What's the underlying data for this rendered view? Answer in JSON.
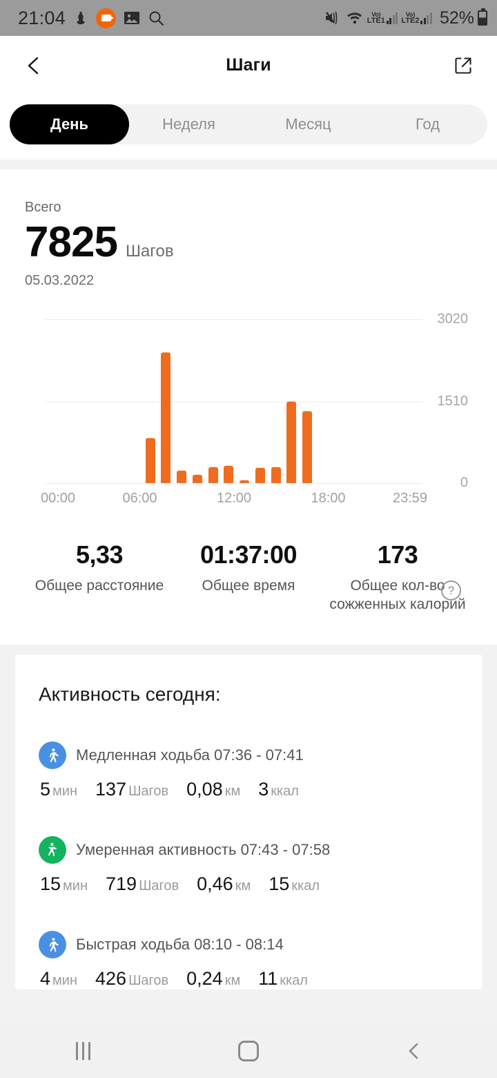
{
  "status_bar": {
    "time": "21:04",
    "left_icons": [
      "alarm-icon",
      "camera-recording-icon",
      "gallery-icon",
      "search-icon"
    ],
    "mute_icon": "mute-vibrate-icon",
    "wifi_icon": "wifi-icon",
    "sim1_label": "LTE1",
    "sim1_volte": "Vo)",
    "sim2_label": "LTE2",
    "sim2_volte": "Vo)",
    "battery_percent": "52%"
  },
  "appbar": {
    "back_icon": "back-chevron-icon",
    "title": "Шаги",
    "share_icon": "external-link-icon"
  },
  "tabs": [
    {
      "label": "День",
      "active": true
    },
    {
      "label": "Неделя",
      "active": false
    },
    {
      "label": "Месяц",
      "active": false
    },
    {
      "label": "Год",
      "active": false
    }
  ],
  "total": {
    "caption": "Всего",
    "value": "7825",
    "unit": "Шагов",
    "date": "05.03.2022"
  },
  "chart_data": {
    "type": "bar",
    "title": "",
    "xlabel": "",
    "ylabel": "",
    "ylim": [
      0,
      3020
    ],
    "grid": true,
    "legend": "none",
    "accent_color": "#ef6c1f",
    "yticks": [
      "0",
      "1510",
      "3020"
    ],
    "ytick_values": [
      0,
      1510,
      3020
    ],
    "xticks": [
      "00:00",
      "06:00",
      "12:00",
      "18:00",
      "23:59"
    ],
    "xtick_hours": [
      0,
      6,
      12,
      18,
      24
    ],
    "categories": [
      "06:40",
      "07:40",
      "08:40",
      "09:40",
      "10:40",
      "11:40",
      "12:40",
      "13:40",
      "14:40",
      "15:40",
      "16:40"
    ],
    "values": [
      830,
      2410,
      235,
      150,
      290,
      320,
      55,
      280,
      290,
      1510,
      1330
    ]
  },
  "summary": [
    {
      "value": "5,33",
      "label": "Общее расстояние"
    },
    {
      "value": "01:37:00",
      "label": "Общее время"
    },
    {
      "value": "173",
      "label": "Общее кол-во сожженных калорий"
    }
  ],
  "help_icon_label": "?",
  "activity": {
    "title": "Активность сегодня:",
    "items": [
      {
        "icon": "walking-person-icon",
        "icon_color": "#4a90e2",
        "name": "Медленная ходьба 07:36 - 07:41",
        "stats": [
          {
            "value": "5",
            "unit": "мин"
          },
          {
            "value": "137",
            "unit": "Шагов"
          },
          {
            "value": "0,08",
            "unit": "км"
          },
          {
            "value": "3",
            "unit": "ккал"
          }
        ]
      },
      {
        "icon": "active-person-icon",
        "icon_color": "#14b35f",
        "name": "Умеренная активность 07:43 - 07:58",
        "stats": [
          {
            "value": "15",
            "unit": "мин"
          },
          {
            "value": "719",
            "unit": "Шагов"
          },
          {
            "value": "0,46",
            "unit": "км"
          },
          {
            "value": "15",
            "unit": "ккал"
          }
        ]
      },
      {
        "icon": "walking-person-icon",
        "icon_color": "#4a90e2",
        "name": "Быстрая ходьба 08:10 - 08:14",
        "stats": [
          {
            "value": "4",
            "unit": "мин"
          },
          {
            "value": "426",
            "unit": "Шагов"
          },
          {
            "value": "0,24",
            "unit": "км"
          },
          {
            "value": "11",
            "unit": "ккал"
          }
        ]
      }
    ]
  },
  "navbar": {
    "recents_label": "recents-icon",
    "home_label": "home-icon",
    "back_label": "back-icon"
  }
}
